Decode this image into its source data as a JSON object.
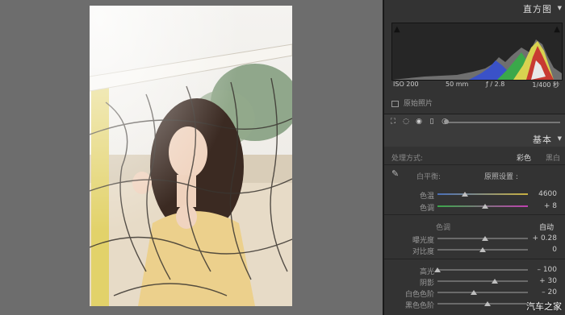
{
  "histogram": {
    "title": "直方图",
    "iso": "ISO 200",
    "focal": "50 mm",
    "aperture": "ƒ / 2.8",
    "shutter": "1/400 秒",
    "original_label": "原始照片"
  },
  "basic": {
    "title": "基本",
    "treatment_label": "处理方式:",
    "color_option": "彩色",
    "bw_option": "黑白",
    "wb_label": "白平衡:",
    "wb_value": "原照设置 :",
    "tone_label": "色调",
    "auto_label": "自动",
    "sliders": [
      {
        "label": "色温",
        "value": "4600",
        "pos": 0.3
      },
      {
        "label": "色调",
        "value": "+ 8",
        "pos": 0.53
      },
      {
        "label": "曝光度",
        "value": "+ 0.28",
        "pos": 0.53
      },
      {
        "label": "对比度",
        "value": "0",
        "pos": 0.5
      },
      {
        "label": "高光",
        "value": "– 100",
        "pos": 0.0
      },
      {
        "label": "阴影",
        "value": "+ 30",
        "pos": 0.63
      },
      {
        "label": "白色色阶",
        "value": "– 20",
        "pos": 0.4
      },
      {
        "label": "黑色色阶",
        "value": "",
        "pos": 0.55
      }
    ]
  },
  "watermark": "汽车之家",
  "colors": {
    "panel": "#333333",
    "canvas": "#6d6d6d"
  }
}
